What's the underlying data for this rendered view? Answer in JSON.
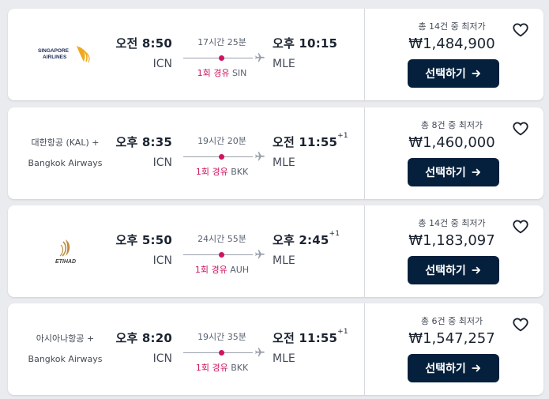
{
  "select_label": "선택하기",
  "flights": [
    {
      "airline": {
        "type": "logo",
        "logo_text": [
          "SINGAPORE",
          "AIRLINES"
        ]
      },
      "dep_time": "오전 8:50",
      "dep_code": "ICN",
      "duration": "17시간 25분",
      "stops": "1회 경유",
      "via": "SIN",
      "arr_time": "오후 10:15",
      "arr_plus": "",
      "arr_code": "MLE",
      "deal": "총 14건 중 최저가",
      "price": "₩1,484,900"
    },
    {
      "airline": {
        "type": "text",
        "name_line1": "대한항공 (KAL) +",
        "name_line2": "Bangkok Airways"
      },
      "dep_time": "오후 8:35",
      "dep_code": "ICN",
      "duration": "19시간 20분",
      "stops": "1회 경유",
      "via": "BKK",
      "arr_time": "오전 11:55",
      "arr_plus": "+1",
      "arr_code": "MLE",
      "deal": "총 8건 중 최저가",
      "price": "₩1,460,000"
    },
    {
      "airline": {
        "type": "logo",
        "logo_text": [
          "ETIHAD"
        ]
      },
      "dep_time": "오후 5:50",
      "dep_code": "ICN",
      "duration": "24시간 55분",
      "stops": "1회 경유",
      "via": "AUH",
      "arr_time": "오후 2:45",
      "arr_plus": "+1",
      "arr_code": "MLE",
      "deal": "총 14건 중 최저가",
      "price": "₩1,183,097"
    },
    {
      "airline": {
        "type": "text",
        "name_line1": "아시아나항공 +",
        "name_line2": "Bangkok Airways"
      },
      "dep_time": "오후 8:20",
      "dep_code": "ICN",
      "duration": "19시간 35분",
      "stops": "1회 경유",
      "via": "BKK",
      "arr_time": "오전 11:55",
      "arr_plus": "+1",
      "arr_code": "MLE",
      "deal": "총 6건 중 최저가",
      "price": "₩1,547,257"
    }
  ],
  "icons": {
    "heart": "heart-outline-icon",
    "plane": "airplane-icon",
    "arrow": "arrow-right-icon"
  }
}
